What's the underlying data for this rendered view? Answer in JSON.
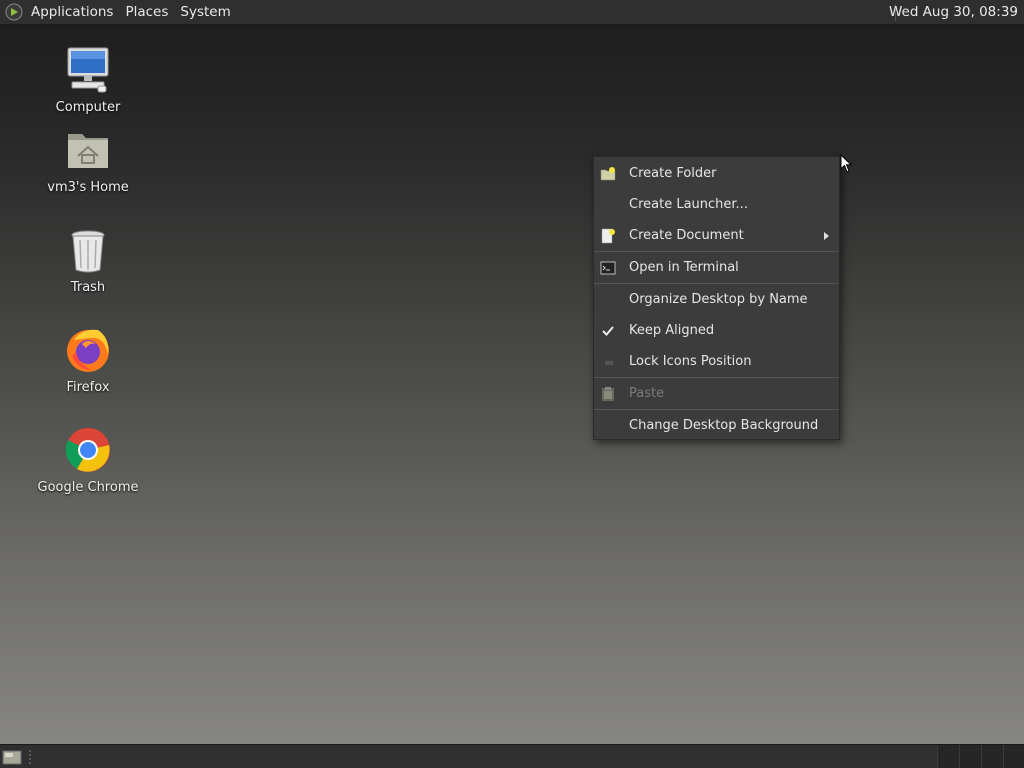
{
  "top_panel": {
    "menus": [
      "Applications",
      "Places",
      "System"
    ],
    "clock": "Wed Aug 30, 08:39"
  },
  "desktop": {
    "icons": [
      {
        "label": "Computer",
        "icon": "computer-icon"
      },
      {
        "label": "vm3's Home",
        "icon": "home-folder-icon"
      },
      {
        "label": "Trash",
        "icon": "trash-icon"
      },
      {
        "label": "Firefox",
        "icon": "firefox-icon"
      },
      {
        "label": "Google Chrome",
        "icon": "chrome-icon"
      }
    ]
  },
  "context_menu": {
    "items": [
      {
        "label": "Create Folder",
        "icon": "new-folder-icon",
        "enabled": true
      },
      {
        "label": "Create Launcher...",
        "icon": "",
        "enabled": true
      },
      {
        "label": "Create Document",
        "icon": "new-document-icon",
        "enabled": true,
        "submenu": true
      },
      {
        "label": "Open in Terminal",
        "icon": "terminal-icon",
        "enabled": true
      },
      {
        "label": "Organize Desktop by Name",
        "icon": "",
        "enabled": true
      },
      {
        "label": "Keep Aligned",
        "icon": "checkmark-icon",
        "enabled": true,
        "checked": true
      },
      {
        "label": "Lock Icons Position",
        "icon": "",
        "enabled": true,
        "checked": false
      },
      {
        "label": "Paste",
        "icon": "paste-icon",
        "enabled": false
      },
      {
        "label": "Change Desktop Background",
        "icon": "",
        "enabled": true
      }
    ]
  },
  "colors": {
    "panel": "#2f2f2f",
    "menu_bg": "#3c3c3c",
    "text": "#e6e6e6",
    "disabled_text": "#7a7a7a"
  }
}
